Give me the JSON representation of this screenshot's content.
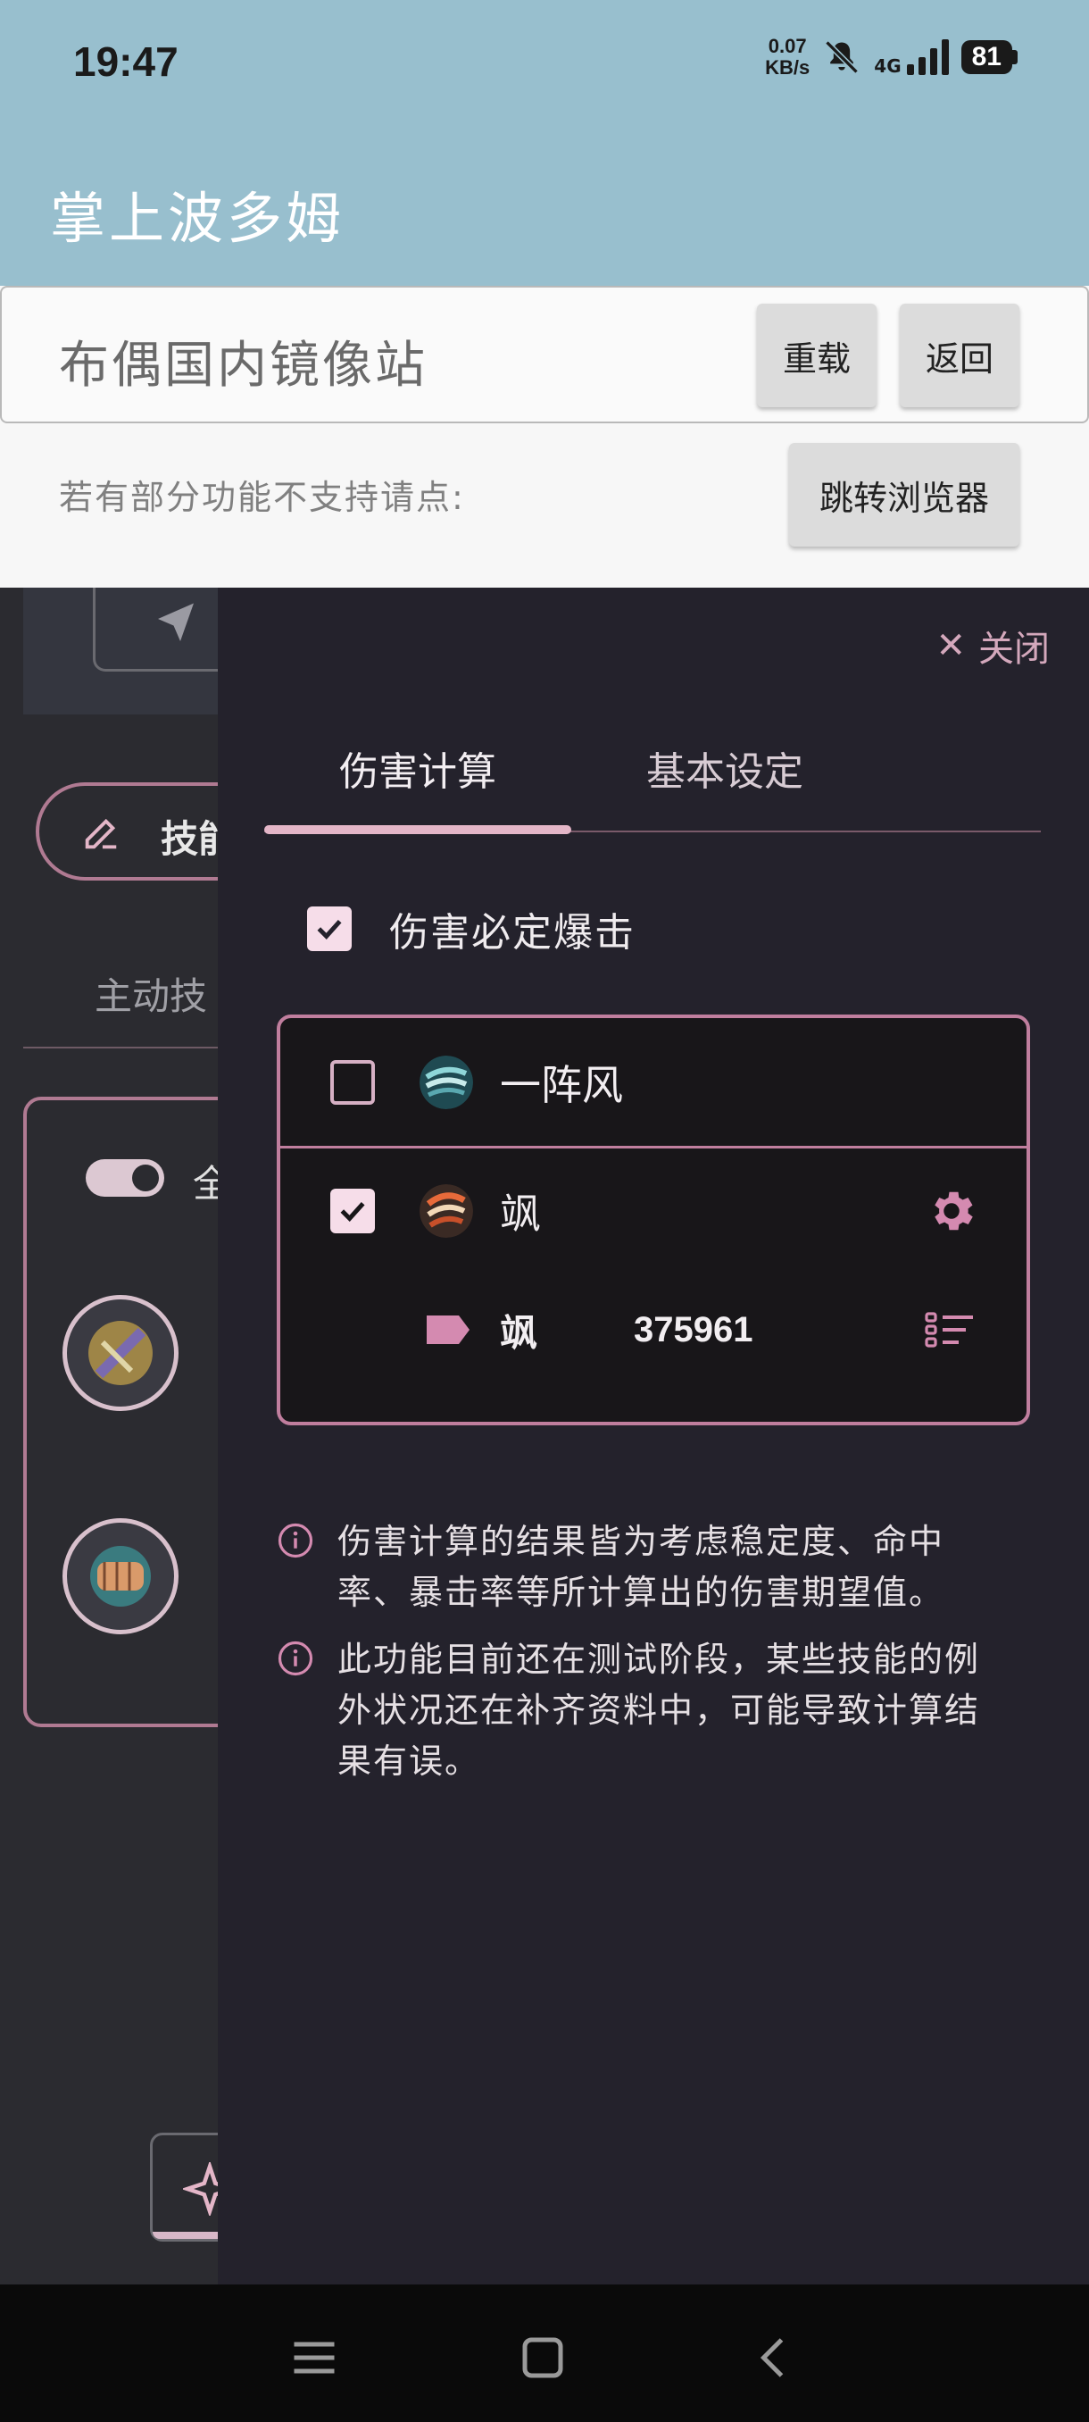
{
  "status_bar": {
    "time": "19:47",
    "net_speed_value": "0.07",
    "net_speed_unit": "KB/s",
    "signal_label": "4G",
    "battery": "81"
  },
  "app": {
    "title": "掌上波多姆"
  },
  "browser": {
    "url_text": "布偶国内镜像站",
    "reload_label": "重载",
    "back_label": "返回",
    "hint_text": "若有部分功能不支持请点:",
    "open_browser_label": "跳转浏览器"
  },
  "background_page": {
    "skill_button_label": "技能",
    "active_tab_label": "主动技",
    "toggle_label": "全"
  },
  "drawer": {
    "close_label": "关闭",
    "tabs": [
      {
        "label": "伤害计算",
        "active": true
      },
      {
        "label": "基本设定",
        "active": false
      }
    ],
    "crit_label": "伤害必定爆击",
    "crit_checked": true,
    "skills": [
      {
        "name": "一阵风",
        "checked": false,
        "icon": "wind-skill-icon"
      },
      {
        "name": "飒",
        "checked": true,
        "icon": "sa-skill-icon"
      }
    ],
    "tag": {
      "name": "飒",
      "value": "375961"
    },
    "notes": [
      "伤害计算的结果皆为考虑稳定度、命中率、暴击率等所计算出的伤害期望值。",
      "此功能目前还在测试阶段，某些技能的例外状况还在补齐资料中，可能导致计算结果有误。"
    ]
  },
  "colors": {
    "header_bg": "#98bfce",
    "accent_pink": "#c07e9e",
    "drawer_bg": "#24222c"
  }
}
